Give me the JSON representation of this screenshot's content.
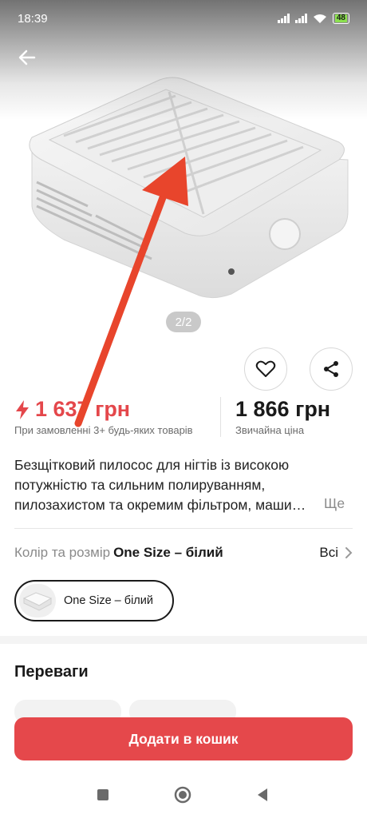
{
  "status_bar": {
    "time": "18:39",
    "battery": "48",
    "icons": [
      "signal-icon",
      "signal-icon",
      "wifi-icon",
      "battery-icon"
    ]
  },
  "gallery": {
    "counter": "2/2"
  },
  "price": {
    "sale": "1 637 грн",
    "sale_note": "При замовленні 3+ будь-яких товарів",
    "regular": "1 866 грн",
    "regular_note": "Звичайна ціна"
  },
  "description": {
    "text": "Безщітковий пилосос для нігтів із високою потужністю та сильним полируванням, пилозахистом та окремим фільтром, маши…",
    "more": "Ще"
  },
  "variant": {
    "label": "Колір та розмір",
    "value": "One Size – білий",
    "all": "Всі",
    "option": "One Size – білий"
  },
  "benefits": {
    "title": "Переваги"
  },
  "cart": {
    "label": "Додати в кошик"
  },
  "colors": {
    "accent": "#e5484b",
    "sale_text": "#e4474b",
    "annotation": "#e8452c"
  }
}
